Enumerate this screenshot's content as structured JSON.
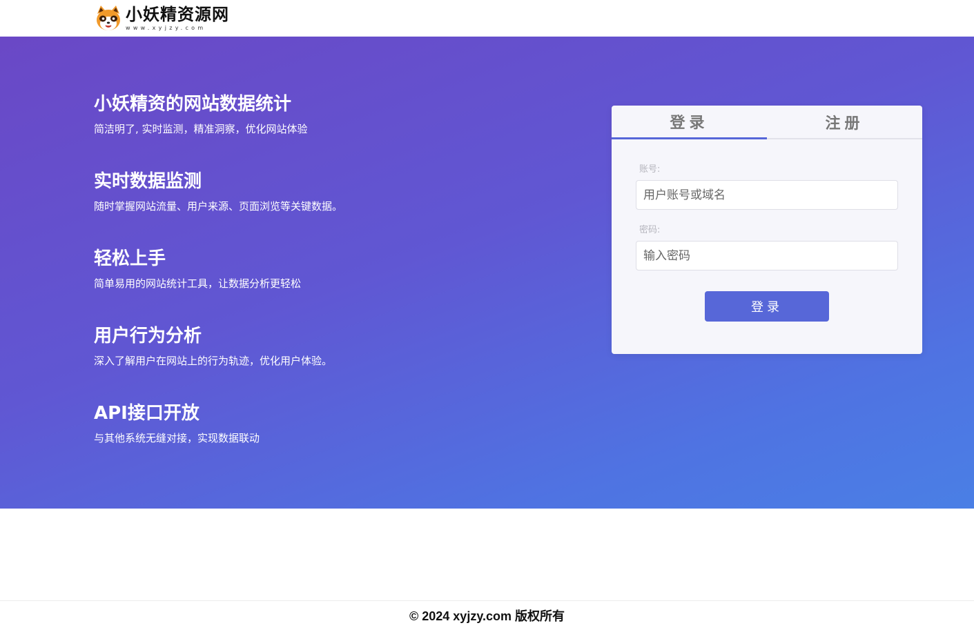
{
  "header": {
    "logo_title": "小妖精资源网",
    "logo_subtitle": "www.xyjzy.com",
    "logo_icon": "raccoon-mascot-icon"
  },
  "features": [
    {
      "title": "小妖精资的网站数据统计",
      "desc": "简洁明了, 实时监测，精准洞察，优化网站体验"
    },
    {
      "title": "实时数据监测",
      "desc": "随时掌握网站流量、用户来源、页面浏览等关键数据。"
    },
    {
      "title": "轻松上手",
      "desc": "简单易用的网站统计工具，让数据分析更轻松"
    },
    {
      "title": "用户行为分析",
      "desc": "深入了解用户在网站上的行为轨迹，优化用户体验。"
    },
    {
      "title": "API接口开放",
      "desc": "与其他系统无缝对接，实现数据联动"
    }
  ],
  "login_card": {
    "tabs": [
      {
        "label": "登录",
        "active": true
      },
      {
        "label": "注册",
        "active": false
      }
    ],
    "account_label": "账号:",
    "account_placeholder": "用户账号或域名",
    "password_label": "密码:",
    "password_placeholder": "输入密码",
    "submit_label": "登录"
  },
  "footer": {
    "text": "© 2024 xyjzy.com 版权所有"
  },
  "colors": {
    "gradient_start": "#6a48c6",
    "gradient_end": "#4a7fe5",
    "button": "#5767d8",
    "card_bg": "#f6f6fb"
  }
}
